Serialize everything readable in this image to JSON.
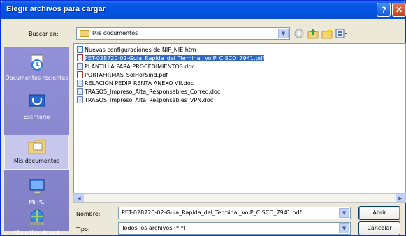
{
  "window": {
    "title": "Elegir archivos para cargar",
    "help_glyph": "?",
    "close_glyph": "✕"
  },
  "lookin": {
    "label": "Buscar en:",
    "value": "Mis documentos"
  },
  "places": [
    {
      "label": "Documentos recientes",
      "icon": "recent-documents-icon"
    },
    {
      "label": "Escritorio",
      "icon": "desktop-icon"
    },
    {
      "label": "Mis documentos",
      "icon": "my-documents-icon",
      "selected": true
    },
    {
      "label": "Mi PC",
      "icon": "my-computer-icon"
    },
    {
      "label": "Mis sitios de red",
      "icon": "network-places-icon"
    }
  ],
  "files": [
    {
      "name": "Nuevas configuraciones de NIF_NIE.htm",
      "type": "htm"
    },
    {
      "name": "PET-028720-02-Guia_Rapida_del_Terminal_VoIP_CISCO_7941.pdf",
      "type": "pdf",
      "selected": true
    },
    {
      "name": "PLANTILLA PARA PROCEDIMIENTOS.doc",
      "type": "doc"
    },
    {
      "name": "PORTAFIRMAS_SolHorSind.pdf",
      "type": "pdf"
    },
    {
      "name": "RELACION PEDIR RENTA ANEXO VII.doc",
      "type": "doc"
    },
    {
      "name": "TRASOS_Impreso_Alta_Responsables_Correo.doc",
      "type": "doc"
    },
    {
      "name": "TRASOS_Impreso_Alta_Responsables_VPN.doc",
      "type": "doc"
    }
  ],
  "form": {
    "name_label": "Nombre:",
    "name_value": "PET-028720-02-Guia_Rapida_del_Terminal_VoIP_CISCO_7941.pdf",
    "type_label": "Tipo:",
    "type_value": "Todos los archivos (*.*)"
  },
  "buttons": {
    "open": "Abrir",
    "cancel": "Cancelar"
  }
}
